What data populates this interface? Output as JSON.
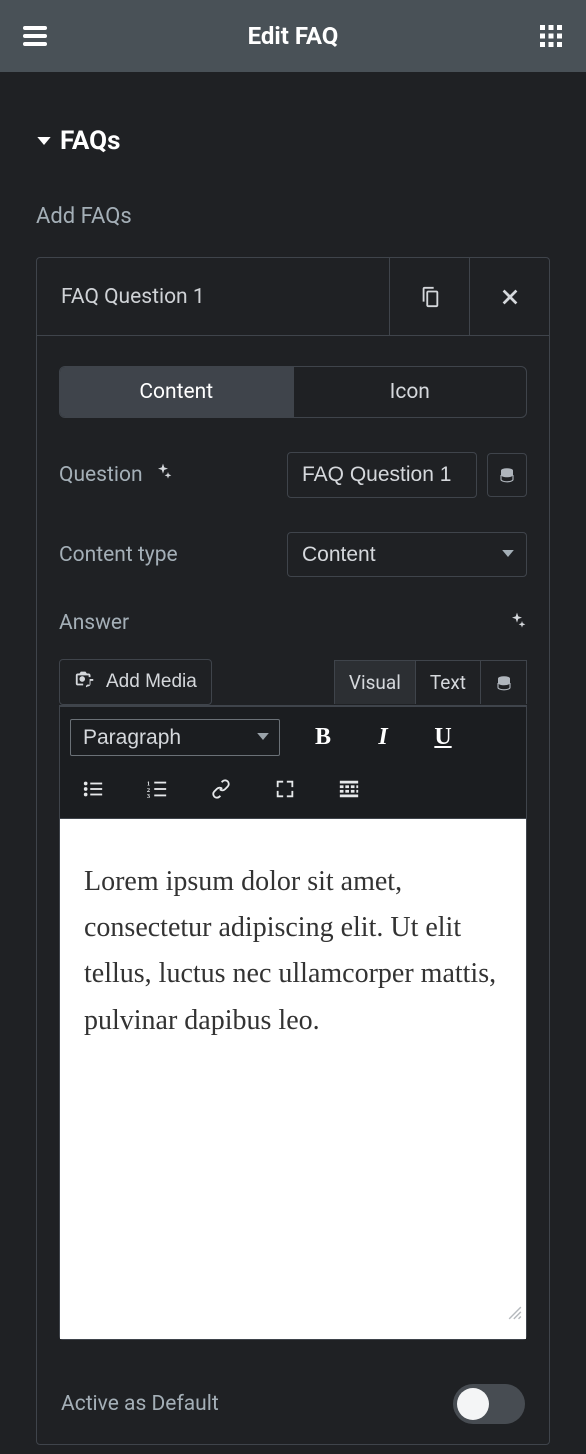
{
  "header": {
    "title": "Edit FAQ"
  },
  "section": {
    "title": "FAQs"
  },
  "add_faqs_label": "Add FAQs",
  "faq_item": {
    "title": "FAQ Question 1",
    "tabs": {
      "content": "Content",
      "icon": "Icon"
    },
    "question_label": "Question",
    "question_value": "FAQ Question 1",
    "content_type_label": "Content type",
    "content_type_value": "Content",
    "answer_label": "Answer",
    "editor": {
      "add_media": "Add Media",
      "tab_visual": "Visual",
      "tab_text": "Text",
      "format_value": "Paragraph",
      "bold": "B",
      "italic": "I",
      "underline": "U",
      "content": "Lorem ipsum dolor sit amet, consectetur adipiscing elit. Ut elit tellus, luctus nec ullamcorper mattis, pulvinar dapibus leo."
    },
    "active_default_label": "Active as Default"
  }
}
